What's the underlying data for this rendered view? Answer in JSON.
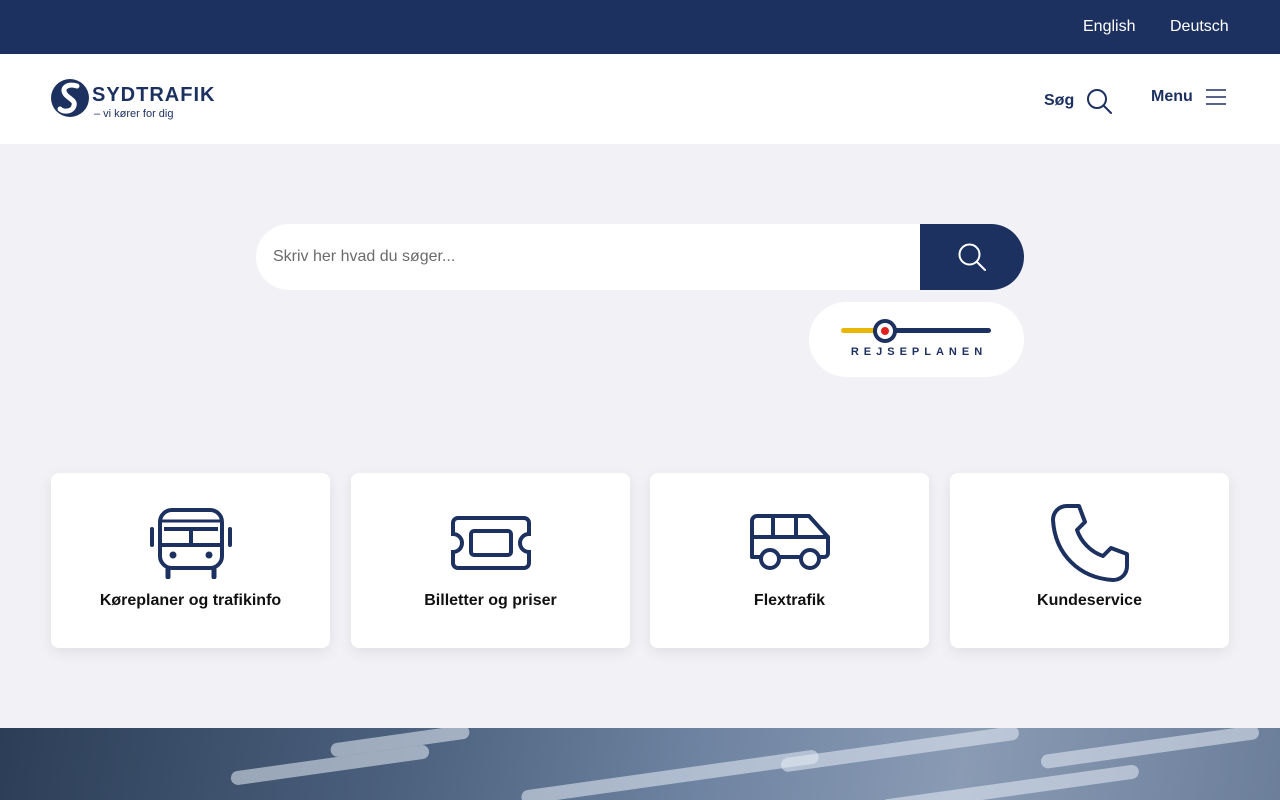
{
  "topbar": {
    "languages": [
      {
        "label": "English"
      },
      {
        "label": "Deutsch"
      }
    ]
  },
  "header": {
    "logo": {
      "word": "SYDTRAFIK",
      "tagline": "– vi kører for dig"
    },
    "search_label": "Søg",
    "menu_label": "Menu"
  },
  "search": {
    "placeholder": "Skriv her hvad du søger..."
  },
  "rejseplanen": {
    "label": "REJSEPLANEN"
  },
  "cards": [
    {
      "title": "Køreplaner og trafikinfo",
      "icon": "bus-icon"
    },
    {
      "title": "Billetter og priser",
      "icon": "ticket-icon"
    },
    {
      "title": "Flextrafik",
      "icon": "van-icon"
    },
    {
      "title": "Kundeservice",
      "icon": "phone-icon"
    }
  ],
  "colors": {
    "brand_navy": "#1d3160",
    "background": "#f2f2f6",
    "rejse_yellow": "#e8b800",
    "rejse_red": "#e02020"
  }
}
